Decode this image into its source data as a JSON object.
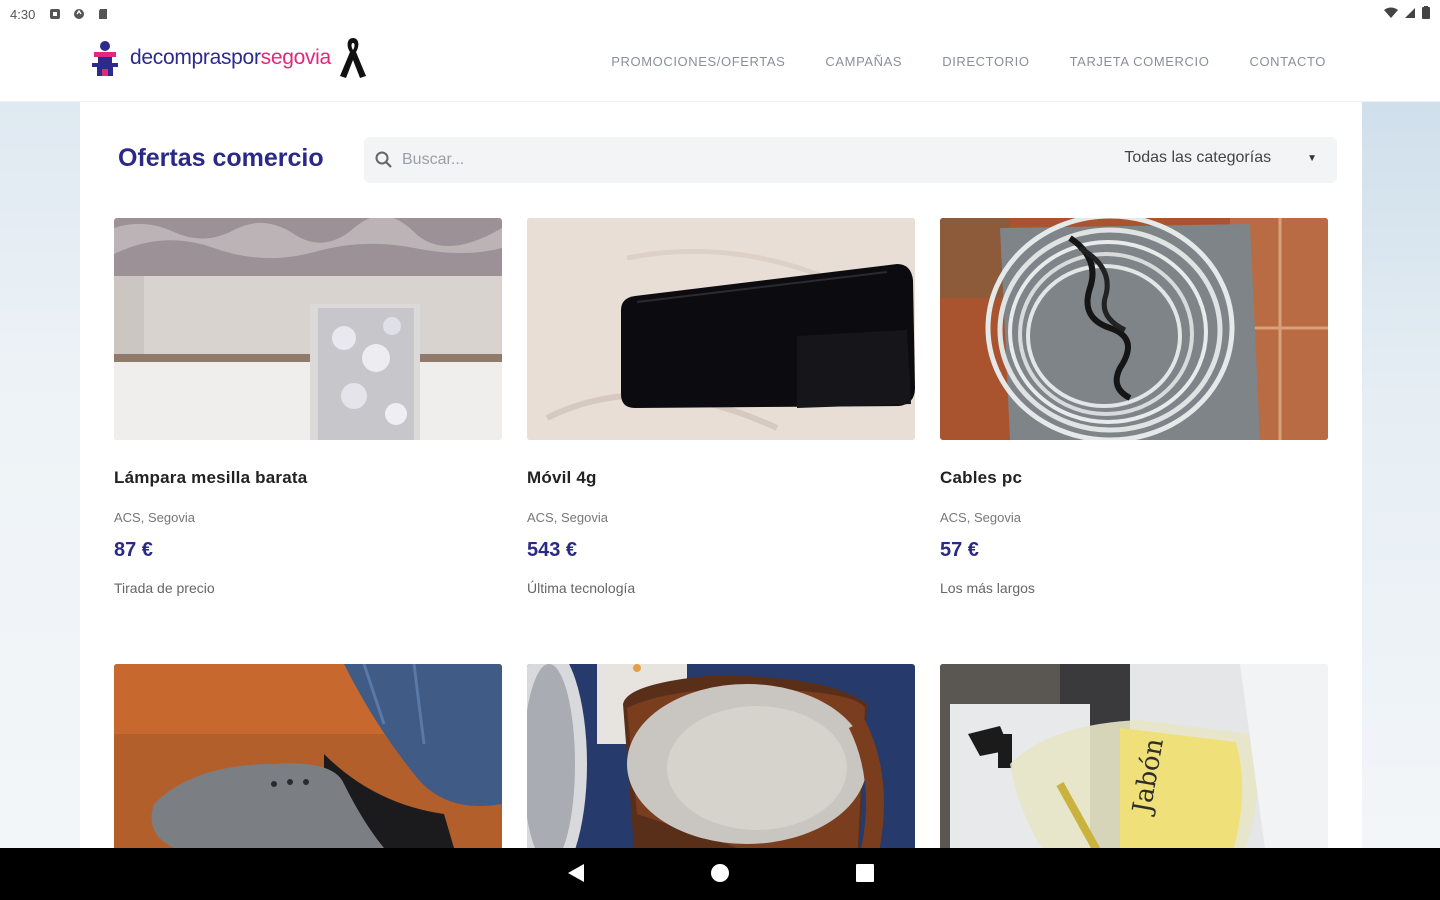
{
  "status_bar": {
    "time": "4:30"
  },
  "brand": {
    "name_part1": "decompraspor",
    "name_part2": "segovia"
  },
  "nav": {
    "items": [
      "PROMOCIONES/OFERTAS",
      "CAMPAÑAS",
      "DIRECTORIO",
      "TARJETA COMERCIO",
      "CONTACTO"
    ]
  },
  "page": {
    "title": "Ofertas comercio"
  },
  "search": {
    "placeholder": "Buscar..."
  },
  "category_select": {
    "selected": "Todas las categorías",
    "icon": "caret-down-icon"
  },
  "products": [
    {
      "title": "Lámpara mesilla barata",
      "location": "ACS, Segovia",
      "price": "87 €",
      "description": "Tirada de precio"
    },
    {
      "title": "Móvil 4g",
      "location": "ACS, Segovia",
      "price": "543 €",
      "description": "Última tecnología"
    },
    {
      "title": "Cables pc",
      "location": "ACS, Segovia",
      "price": "57 €",
      "description": "Los más largos"
    },
    {
      "title": "",
      "location": "",
      "price": "",
      "description": ""
    },
    {
      "title": "",
      "location": "",
      "price": "",
      "description": ""
    },
    {
      "title": "",
      "location": "",
      "price": "",
      "description": ""
    }
  ],
  "photo_text": {
    "soap_label": "Jabón"
  },
  "colors": {
    "brand_navy": "#2a2a86",
    "brand_pink": "#e5277c",
    "nav_text": "#8a8f99"
  }
}
